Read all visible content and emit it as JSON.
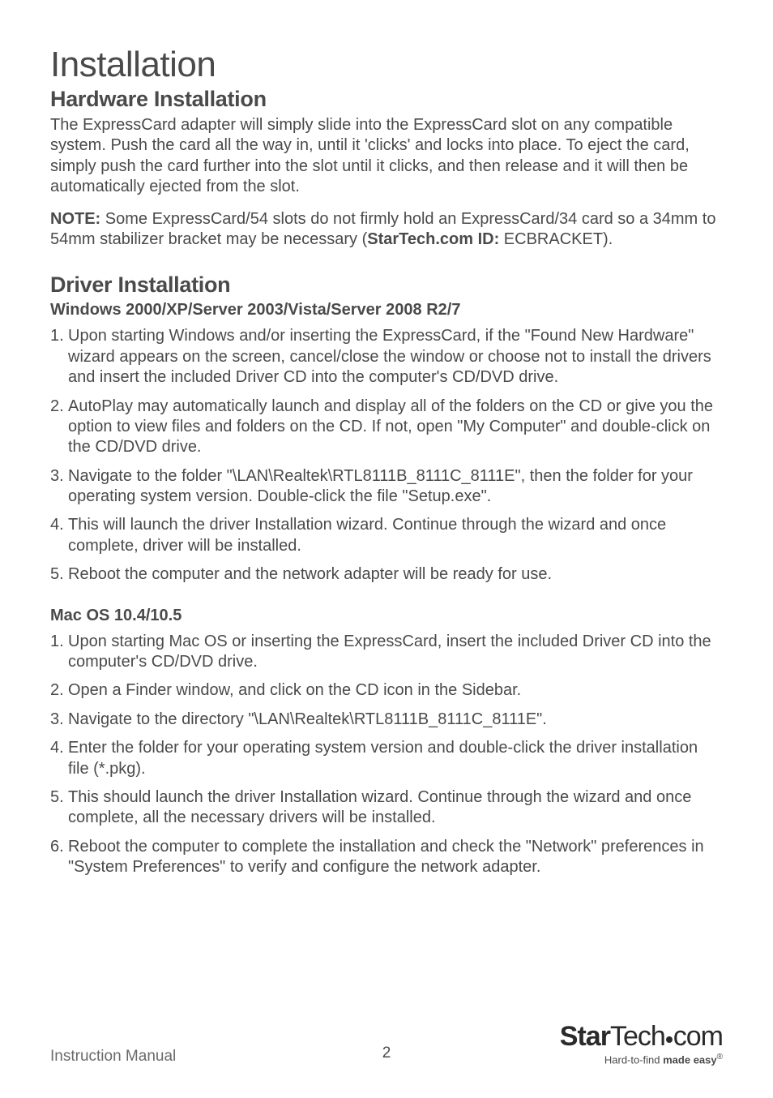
{
  "page_title": "Installation",
  "hardware": {
    "heading": "Hardware Installation",
    "para1": "The ExpressCard adapter will simply slide into the ExpressCard slot on any compatible system. Push the card all the way in, until it 'clicks' and locks into place. To eject the card, simply push the card further into the slot until it clicks, and then release and it will then be automatically ejected from the slot.",
    "note_label": "NOTE:",
    "note_text_1": " Some ExpressCard/54 slots do not firmly hold an ExpressCard/34 card so a 34mm to 54mm stabilizer bracket may be necessary (",
    "note_bold": "StarTech.com ID:",
    "note_text_2": " ECBRACKET)."
  },
  "driver": {
    "heading": "Driver Installation",
    "windows": {
      "heading": "Windows 2000/XP/Server 2003/Vista/Server 2008 R2/7",
      "steps": [
        "Upon starting Windows and/or inserting the ExpressCard, if the \"Found New Hardware\" wizard appears on the screen, cancel/close the window or choose not to install the drivers and insert the included Driver CD into the computer's CD/DVD drive.",
        "AutoPlay may automatically launch and display all of the folders on the CD or give you the option to view files and folders on the CD.  If not, open \"My Computer\" and double-click on the CD/DVD drive.",
        "Navigate to the folder \"\\LAN\\Realtek\\RTL8111B_8111C_8111E\", then the folder for your operating system version.  Double-click the file \"Setup.exe\".",
        "This will launch the driver Installation wizard.  Continue through the wizard and once complete, driver will be installed.",
        "Reboot the computer and the network adapter will be ready for use."
      ]
    },
    "mac": {
      "heading": "Mac OS 10.4/10.5",
      "steps": [
        "Upon starting Mac OS or inserting the ExpressCard, insert the included Driver CD into the computer's CD/DVD drive.",
        "Open a Finder window, and click on the CD icon in the Sidebar.",
        "Navigate to the directory \"\\LAN\\Realtek\\RTL8111B_8111C_8111E\".",
        "Enter the folder for your operating system version and double-click the driver installation file (*.pkg).",
        "This should launch the driver Installation wizard.  Continue through the wizard and once complete, all the necessary drivers will be installed.",
        "Reboot the computer to complete the installation and check the \"Network\" preferences in \"System Preferences\" to verify and configure the network adapter."
      ]
    }
  },
  "footer": {
    "left": "Instruction Manual",
    "page_number": "2",
    "logo_brand_1": "Star",
    "logo_brand_2": "Tech",
    "logo_brand_3": "com",
    "tagline_1": "Hard-to-find ",
    "tagline_2": "made easy",
    "reg": "®"
  }
}
